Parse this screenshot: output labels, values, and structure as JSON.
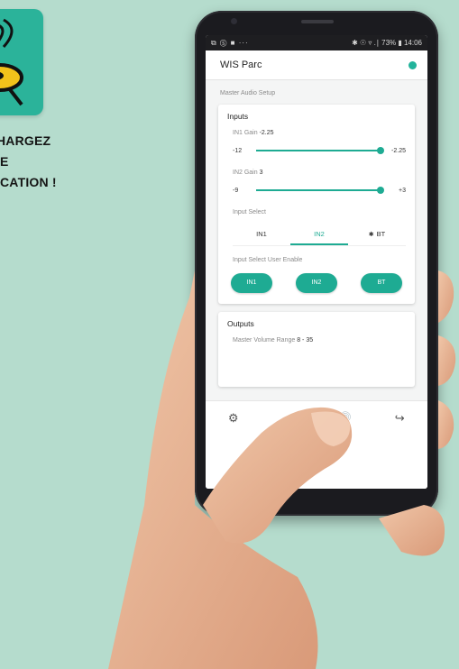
{
  "promo": {
    "line1": "HARGEZ",
    "line2": "E",
    "line3": "CATION !"
  },
  "status_bar": {
    "left_icons": "⧉ Ⓢ ■ ···",
    "right": "✱ ☉ ▿ .∣ 73% ▮ 14:06"
  },
  "app": {
    "title": "WIS Parc",
    "connection_color": "#22b39b",
    "accent": "#1eab93",
    "section_title": "Master Audio Setup",
    "inputs": {
      "title": "Inputs",
      "in1_gain": {
        "label": "IN1 Gain",
        "value": "-2.25",
        "min": "-12",
        "max": "-2.25",
        "fraction": 1.0
      },
      "in2_gain": {
        "label": "IN2 Gain",
        "value": "3",
        "min": "-9",
        "max": "+3",
        "fraction": 1.0
      },
      "input_select": {
        "label": "Input Select",
        "options": [
          "IN1",
          "IN2",
          "BT"
        ],
        "selected": "IN2"
      },
      "user_enable": {
        "label": "Input Select User Enable",
        "buttons": [
          "IN1",
          "IN2",
          "BT"
        ]
      }
    },
    "outputs": {
      "title": "Outputs",
      "master_volume_label": "Master Volume Range",
      "master_volume_value": "8 - 35"
    },
    "bottom_nav": [
      "gear-icon",
      "sliders-icon",
      "speaker-icon",
      "logout-icon"
    ]
  }
}
